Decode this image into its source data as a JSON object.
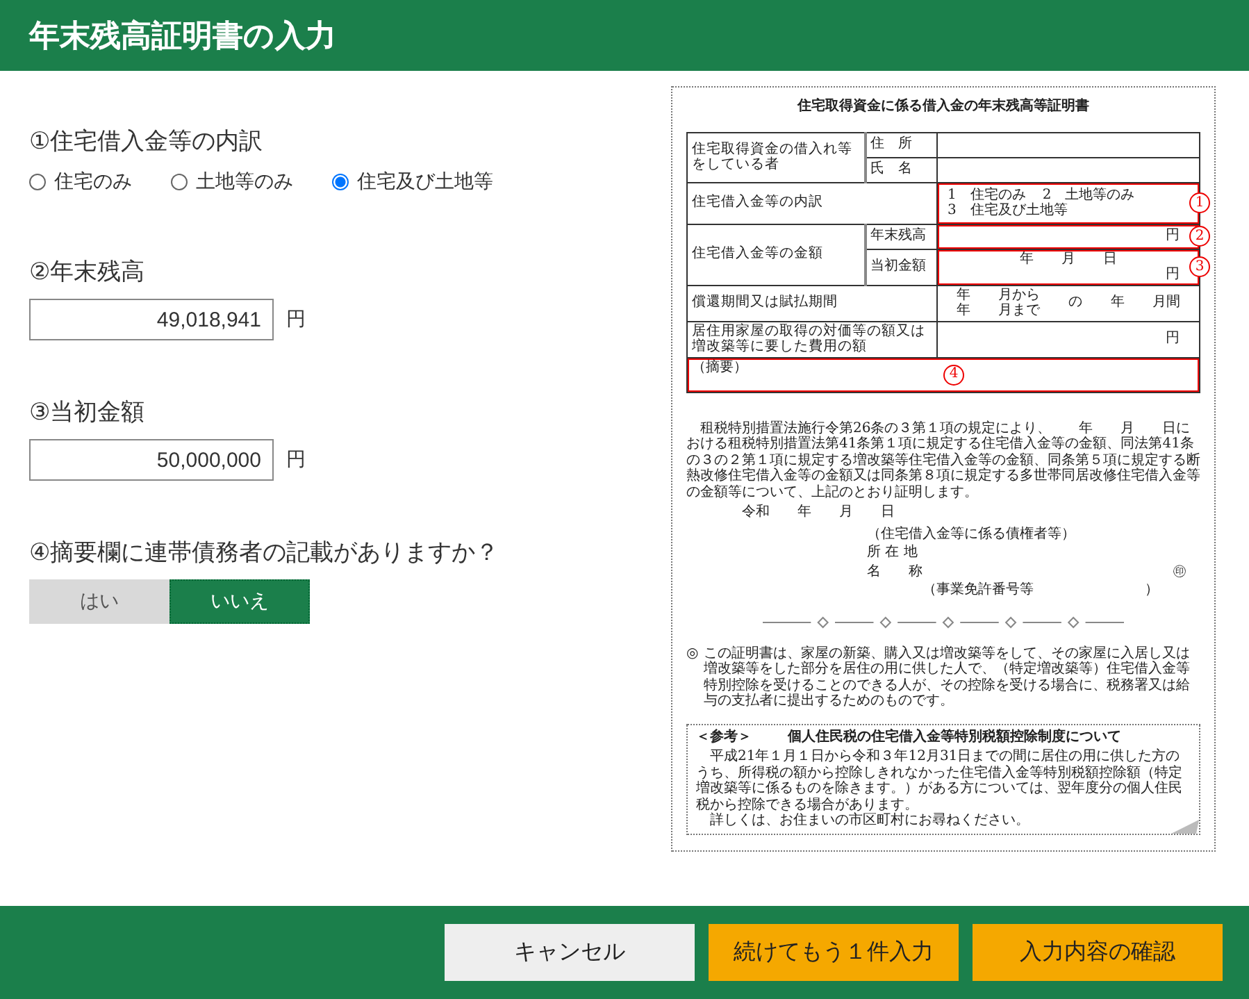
{
  "title": "年末残高証明書の入力",
  "breakdown": {
    "label": "①住宅借入金等の内訳",
    "options": [
      {
        "label": "住宅のみ",
        "selected": false
      },
      {
        "label": "土地等のみ",
        "selected": false
      },
      {
        "label": "住宅及び土地等",
        "selected": true
      }
    ]
  },
  "year_end_balance": {
    "label": "②年末残高",
    "value": "49,018,941",
    "unit": "円"
  },
  "initial_amount": {
    "label": "③当初金額",
    "value": "50,000,000",
    "unit": "円"
  },
  "joint_debtor": {
    "label": "④摘要欄に連帯債務者の記載がありますか？",
    "options": [
      {
        "label": "はい",
        "selected": false
      },
      {
        "label": "いいえ",
        "selected": true
      }
    ]
  },
  "document": {
    "title": "住宅取得資金に係る借入金の年末残高等証明書",
    "borrower": {
      "label": "住宅取得資金の借入れ等をしている者",
      "address_label": "住　所",
      "name_label": "氏　名"
    },
    "breakdown": {
      "label": "住宅借入金等の内訳",
      "options": [
        "1　住宅のみ",
        "2　土地等のみ",
        "3　住宅及び土地等"
      ],
      "marker": "1"
    },
    "amount": {
      "label": "住宅借入金等の金額",
      "balance_label": "年末残高",
      "balance_unit": "円",
      "balance_marker": "2",
      "initial_label": "当初金額",
      "initial_date": "年　　月　　日",
      "initial_unit": "円",
      "initial_marker": "3"
    },
    "period": {
      "label": "償還期間又は賦払期間",
      "from": "年　　月から",
      "to": "年　　月まで",
      "of": "の",
      "length": "年　　月間"
    },
    "cost": {
      "label": "居住用家屋の取得の対価等の額又は増改築等に要した費用の額",
      "unit": "円"
    },
    "remarks": {
      "label": "（摘要）",
      "marker": "4"
    },
    "statement": "租税特別措置法施行令第26条の３第１項の規定により、　　年　　月　　日における租税特別措置法第41条第１項に規定する住宅借入金等の金額、同法第41条の３の２第１項に規定する増改築等住宅借入金等の金額、同条第５項に規定する断熱改修住宅借入金等の金額又は同条第８項に規定する多世帯同居改修住宅借入金等の金額等について、上記のとおり証明します。",
    "date": "令和　　年　　月　　日",
    "certifier": {
      "heading": "（住宅借入金等に係る債権者等）",
      "address_label": "所 在 地",
      "name_label": "名　　称",
      "seal": "㊞",
      "license": "（事業免許番号等　　　　　　　　）"
    },
    "note": {
      "mark": "◎",
      "text": "この証明書は、家屋の新築、購入又は増改築等をして、その家屋に入居し又は増改築等をした部分を居住の用に供した人で、（特定増改築等）住宅借入金等特別控除を受けることのできる人が、その控除を受ける場合に、税務署又は給与の支払者に提出するためのものです。"
    },
    "reference": {
      "label": "＜参考＞",
      "title": "個人住民税の住宅借入金等特別税額控除制度について",
      "body": [
        "平成21年１月１日から令和３年12月31日までの間に居住の用に供した方のうち、所得税の額から控除しきれなかった住宅借入金等特別税額控除額（特定増改築等に係るものを除きます。）がある方については、翌年度分の個人住民税から控除できる場合があります。",
        "詳しくは、お住まいの市区町村にお尋ねください。"
      ]
    }
  },
  "buttons": [
    {
      "label": "キャンセル",
      "kind": "secondary"
    },
    {
      "label": "続けてもう１件入力",
      "kind": "primary"
    },
    {
      "label": "入力内容の確認",
      "kind": "primary"
    }
  ]
}
